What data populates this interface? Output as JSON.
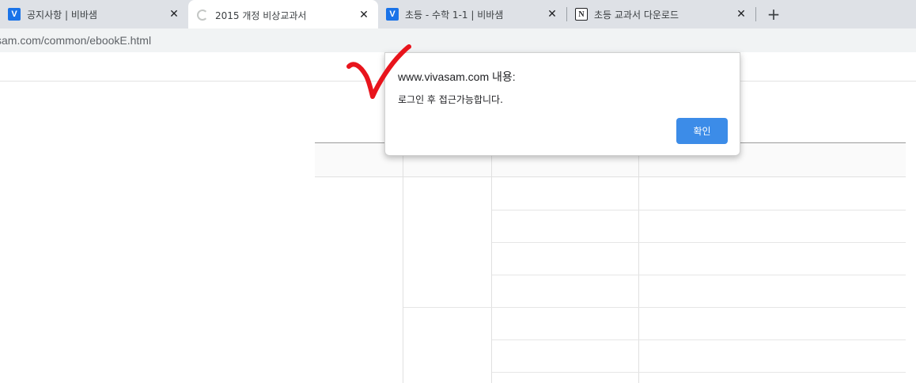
{
  "browser": {
    "tabs": [
      {
        "title": "공지사항 | 비바샘",
        "favicon": "V",
        "active": false
      },
      {
        "title": "2015 개정 비상교과서",
        "favicon": "loading-spinner",
        "active": true
      },
      {
        "title": "초등 - 수학 1-1 | 비바샘",
        "favicon": "V",
        "active": false
      },
      {
        "title": "초등 교과서 다운로드",
        "favicon": "N",
        "active": false
      }
    ],
    "close_glyph": "✕",
    "new_tab_glyph": "+",
    "url": "sam.com/common/ebookE.html"
  },
  "dialog": {
    "title": "www.vivasam.com 내용:",
    "message": "로그인 후 접근가능합니다.",
    "ok_label": "확인",
    "ok_color": "#3c8ce8"
  },
  "annotation": {
    "mark": "red-checkmark",
    "color": "#e8141c"
  }
}
